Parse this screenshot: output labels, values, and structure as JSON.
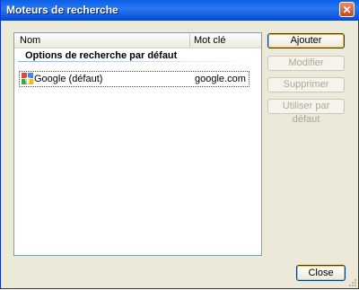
{
  "window": {
    "title": "Moteurs de recherche",
    "close_glyph": "✕"
  },
  "list": {
    "columns": [
      "Nom",
      "Mot clé"
    ],
    "group_label": "Options de recherche par défaut",
    "rows": [
      {
        "name": "Google (défaut)",
        "keyword": "google.com",
        "icon": "google-icon"
      }
    ]
  },
  "buttons": {
    "add": "Ajouter",
    "edit": "Modifier",
    "delete": "Supprimer",
    "set_default": "Utiliser par défaut",
    "close": "Close"
  }
}
